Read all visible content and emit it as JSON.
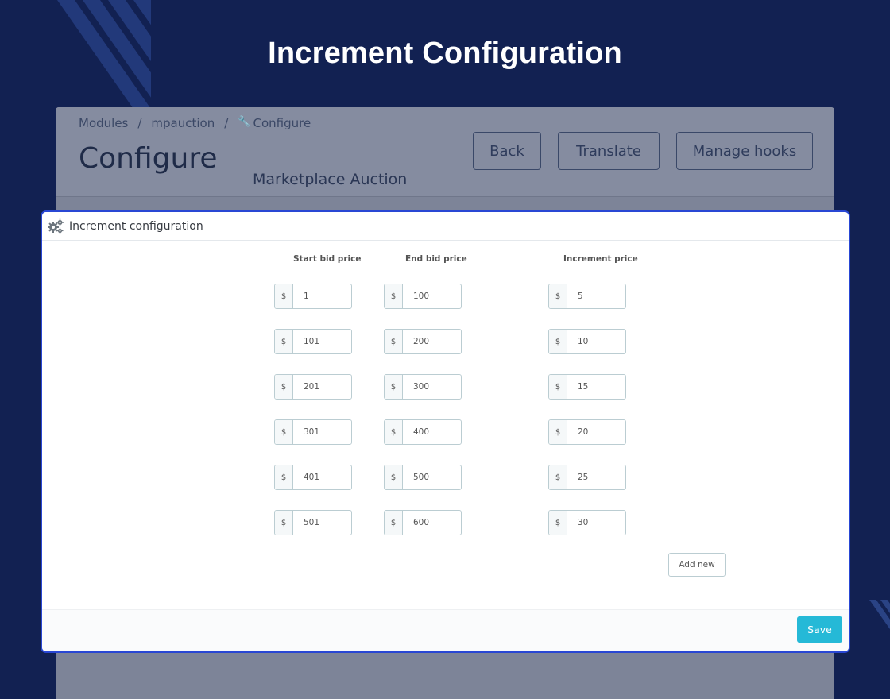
{
  "hero": {
    "title": "Increment Configuration"
  },
  "admin": {
    "breadcrumb": [
      "Modules",
      "mpauction",
      "Configure"
    ],
    "heading": "Configure",
    "subtitle": "Marketplace Auction",
    "buttons": {
      "back": "Back",
      "translate": "Translate",
      "hooks": "Manage hooks"
    }
  },
  "panel": {
    "title": "Increment configuration",
    "columns": {
      "start": "Start bid price",
      "end": "End bid price",
      "increment": "Increment price"
    },
    "currency_symbol": "$",
    "rows": [
      {
        "start": "1",
        "end": "100",
        "increment": "5"
      },
      {
        "start": "101",
        "end": "200",
        "increment": "10"
      },
      {
        "start": "201",
        "end": "300",
        "increment": "15"
      },
      {
        "start": "301",
        "end": "400",
        "increment": "20"
      },
      {
        "start": "401",
        "end": "500",
        "increment": "25"
      },
      {
        "start": "501",
        "end": "600",
        "increment": "30"
      }
    ],
    "add_new_label": "Add new",
    "save_label": "Save"
  },
  "colors": {
    "page_bg": "#122152",
    "panel_border": "#2947d4",
    "save_button": "#25b9d7"
  }
}
